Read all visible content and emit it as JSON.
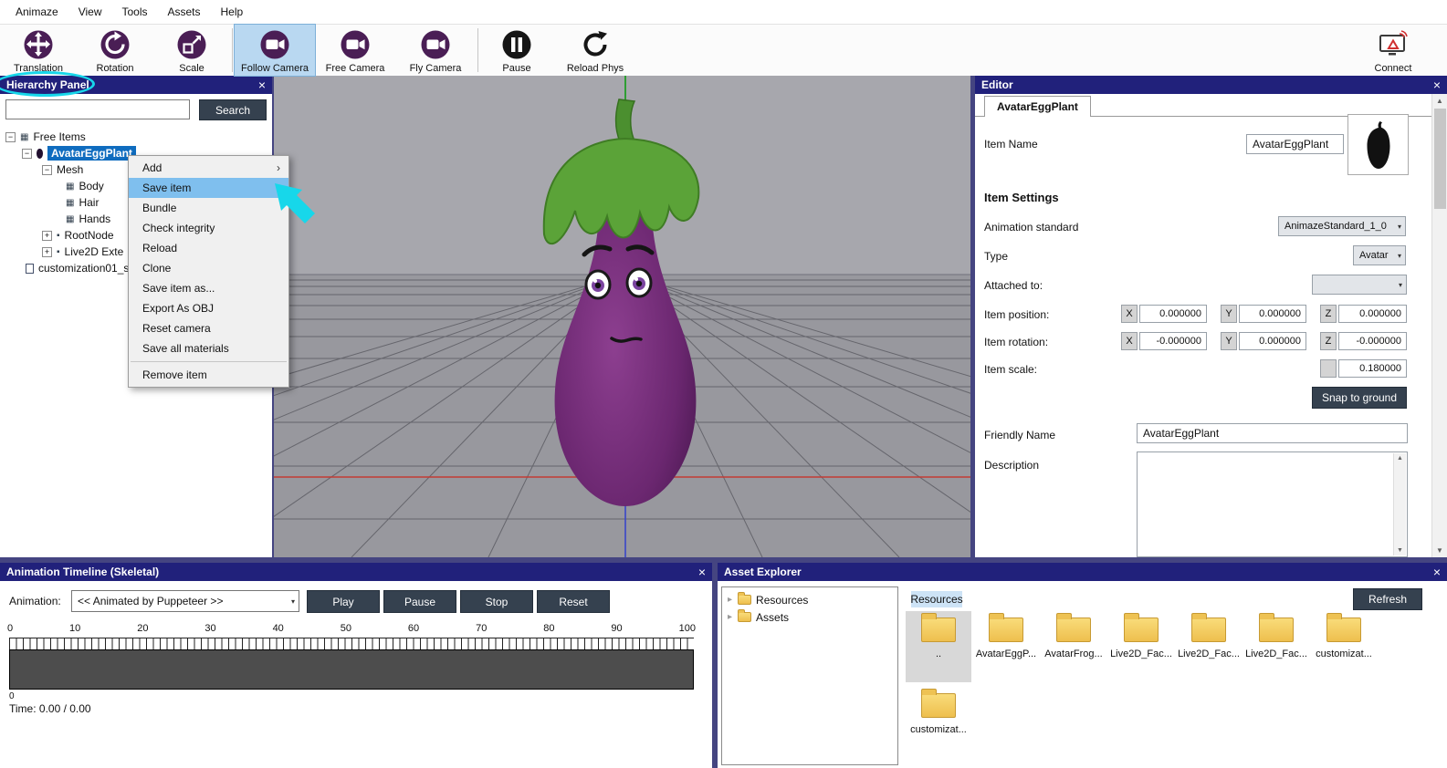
{
  "menubar": {
    "items": [
      "Animaze",
      "View",
      "Tools",
      "Assets",
      "Help"
    ]
  },
  "toolbar": {
    "tools": [
      {
        "label": "Translation"
      },
      {
        "label": "Rotation"
      },
      {
        "label": "Scale"
      },
      {
        "label": "Follow Camera"
      },
      {
        "label": "Free Camera"
      },
      {
        "label": "Fly Camera"
      },
      {
        "label": "Pause"
      },
      {
        "label": "Reload Phys"
      }
    ],
    "connect_label": "Connect"
  },
  "hierarchy": {
    "title": "Hierarchy Panel",
    "search_value": "",
    "search_button": "Search",
    "tree": {
      "free_items": "Free Items",
      "avatar": "AvatarEggPlant",
      "mesh": "Mesh",
      "body": "Body",
      "hair": "Hair",
      "hands": "Hands",
      "root_node": "RootNode",
      "live2d": "Live2D Exte",
      "customization": "customization01_s"
    },
    "context_menu": {
      "items": [
        "Add",
        "Save item",
        "Bundle",
        "Check integrity",
        "Reload",
        "Clone",
        "Save item as...",
        "Export As OBJ",
        "Reset camera",
        "Save all materials",
        "Remove item"
      ]
    }
  },
  "editor": {
    "title": "Editor",
    "tab": "AvatarEggPlant",
    "item_name_label": "Item Name",
    "item_name_value": "AvatarEggPlant",
    "item_settings_label": "Item Settings",
    "animation_standard_label": "Animation standard",
    "animation_standard_value": "AnimazeStandard_1_0",
    "type_label": "Type",
    "type_value": "Avatar",
    "attached_to_label": "Attached to:",
    "item_position_label": "Item position:",
    "position": {
      "x": "0.000000",
      "y": "0.000000",
      "z": "0.000000"
    },
    "item_rotation_label": "Item rotation:",
    "rotation": {
      "x": "-0.000000",
      "y": "0.000000",
      "z": "-0.000000"
    },
    "item_scale_label": "Item scale:",
    "item_scale_value": "0.180000",
    "snap_to_ground_label": "Snap to ground",
    "friendly_name_label": "Friendly Name",
    "friendly_name_value": "AvatarEggPlant",
    "description_label": "Description",
    "description_value": "",
    "axis": {
      "x": "X",
      "y": "Y",
      "z": "Z"
    }
  },
  "timeline": {
    "title": "Animation Timeline (Skeletal)",
    "animation_label": "Animation:",
    "animation_value": "<< Animated by Puppeteer >>",
    "play": "Play",
    "pause": "Pause",
    "stop": "Stop",
    "reset": "Reset",
    "ruler": [
      "0",
      "10",
      "20",
      "30",
      "40",
      "50",
      "60",
      "70",
      "80",
      "90",
      "100"
    ],
    "zero_label": "0",
    "time_label": "Time: 0.00 / 0.00"
  },
  "asset_explorer": {
    "title": "Asset Explorer",
    "tree": {
      "resources": "Resources",
      "assets": "Assets"
    },
    "tab": "Resources",
    "refresh_label": "Refresh",
    "folders_row1": [
      "..",
      "AvatarEggP...",
      "AvatarFrog...",
      "Live2D_Fac...",
      "Live2D_Fac...",
      "Live2D_Fac...",
      "customizat..."
    ],
    "folders_row2": [
      "customizat..."
    ]
  },
  "glyphs": {
    "close": "×",
    "combo_arrow": "▾",
    "chevron": "▸",
    "submenu_arrow": "›",
    "up": "▲",
    "down": "▼",
    "plus": "+",
    "minus": "−"
  }
}
